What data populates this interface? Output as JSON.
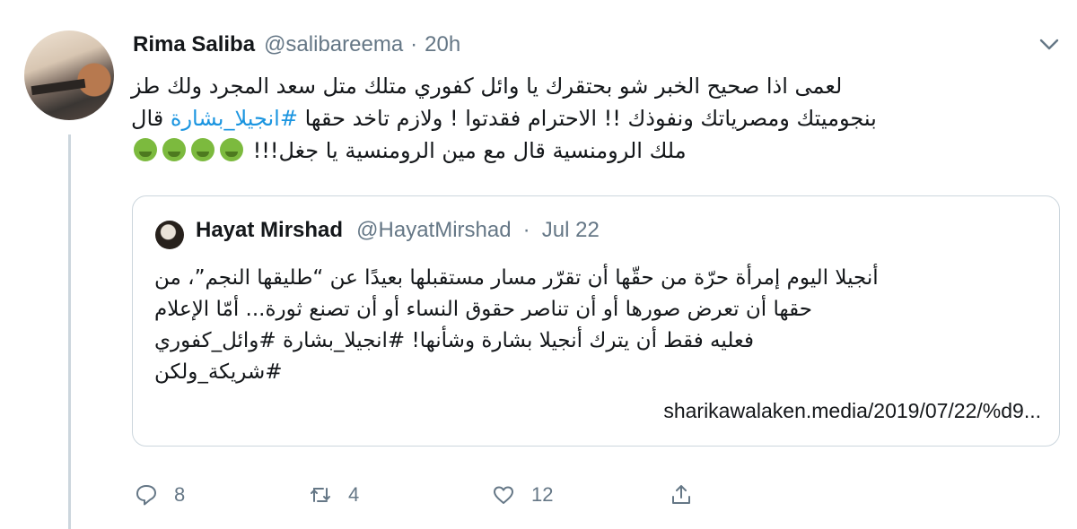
{
  "tweet": {
    "author_name": "Rima Saliba",
    "author_handle": "@salibareema",
    "separator": "·",
    "time": "20h",
    "text_lines": [
      "لعمى اذا صحيح الخبر شو بحتقرك يا وائل كفوري متلك متل سعد المجرد ولك طز",
      "بنجوميتك ومصرياتك ونفوذك !! الاحترام فقدتوا ! ولازم تاخد حقها",
      "ملك الرومنسية قال مع مين الرومنسية يا جغل!!!"
    ],
    "line2_hashtag": "#انجيلا_بشارة",
    "line2_after": "قال",
    "emoji_name": "nauseated-face-emoji",
    "emoji_count": 4
  },
  "quoted": {
    "author_name": "Hayat Mirshad",
    "author_handle": "@HayatMirshad",
    "separator": "·",
    "time": "Jul 22",
    "text_lines": [
      "أنجيلا اليوم إمرأة حرّة من حقّها أن تقرّر مسار مستقبلها بعيدًا عن “طليقها النجم”، من",
      "حقها أن تعرض صورها أو أن تناصر حقوق النساء أو أن تصنع ثورة... أمّا الإعلام",
      "فعليه فقط أن يترك أنجيلا بشارة وشأنها! #انجيلا_بشارة #وائل_كفوري",
      "#شريكة_ولكن"
    ],
    "link": "sharikawalaken.media/2019/07/22/%d9..."
  },
  "actions": {
    "replies": "8",
    "retweets": "4",
    "likes": "12"
  },
  "colors": {
    "link": "#1b95e0",
    "muted": "#657786",
    "border": "#ccd6dd"
  }
}
